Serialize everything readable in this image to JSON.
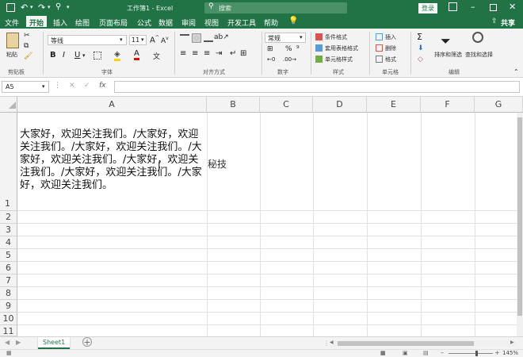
{
  "titlebar": {
    "title": "工作簿1 - Excel",
    "search_placeholder": "搜索",
    "login_label": "登录"
  },
  "tabs": [
    "文件",
    "开始",
    "插入",
    "绘图",
    "页面布局",
    "公式",
    "数据",
    "审阅",
    "视图",
    "开发工具",
    "帮助"
  ],
  "share_label": "共享",
  "ribbon": {
    "paste_label": "粘贴",
    "clipboard_label": "剪贴板",
    "font_name": "等线",
    "font_size": "11",
    "font_group_label": "字体",
    "align_group_label": "对齐方式",
    "number_format": "常规",
    "number_group_label": "数字",
    "cond_format": "条件格式",
    "table_format": "套用表格格式",
    "cell_style": "单元格样式",
    "styles_group_label": "样式",
    "insert_label": "插入",
    "delete_label": "删除",
    "format_label": "格式",
    "cells_group_label": "单元格",
    "sort_filter": "排序和筛选",
    "find_select": "查找和选择",
    "editing_group_label": "编辑",
    "bold": "B",
    "italic": "I",
    "underline": "U",
    "font_color_letter": "A",
    "sigma": "Σ"
  },
  "formula": {
    "name_box": "A5",
    "fx": "fx",
    "value": ""
  },
  "grid": {
    "columns": [
      "A",
      "B",
      "C",
      "D",
      "E",
      "F",
      "G"
    ],
    "rows": [
      "1",
      "2",
      "3",
      "4",
      "5",
      "6",
      "7",
      "8",
      "9",
      "10",
      "11"
    ],
    "cell_a1_lines": [
      "大家好，欢迎关注我们。/大家好，欢迎",
      "关注我们。/大家好，欢迎关注我们。/大",
      "家好，欢迎关注我们。/大家好，欢迎关",
      "注我们。/大家好，欢迎关注我们。/大家",
      "好，欢迎关注我们。"
    ],
    "overflow_text": "秘技"
  },
  "sheets": {
    "active": "Sheet1",
    "add": "+"
  },
  "status": {
    "zoom": "145%"
  },
  "colors": {
    "excel_green": "#217346"
  }
}
